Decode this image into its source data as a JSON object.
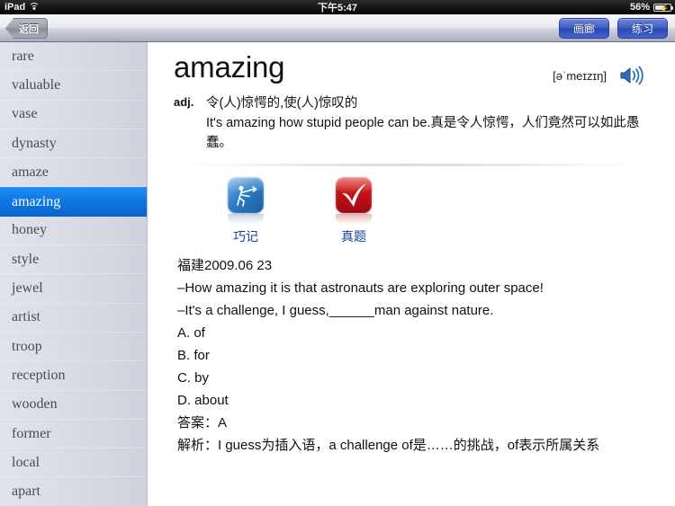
{
  "status_bar": {
    "device": "iPad",
    "wifi_icon": "wifi-icon",
    "time": "下午5:47",
    "battery_percent": "56%",
    "battery_icon": "battery-charging-icon"
  },
  "toolbar": {
    "back_label": "返回",
    "gallery_label": "画廊",
    "practice_label": "练习"
  },
  "sidebar": {
    "items": [
      {
        "label": "rare",
        "selected": false
      },
      {
        "label": "valuable",
        "selected": false
      },
      {
        "label": "vase",
        "selected": false
      },
      {
        "label": "dynasty",
        "selected": false
      },
      {
        "label": "amaze",
        "selected": false
      },
      {
        "label": "amazing",
        "selected": true
      },
      {
        "label": "honey",
        "selected": false
      },
      {
        "label": "style",
        "selected": false
      },
      {
        "label": "jewel",
        "selected": false
      },
      {
        "label": "artist",
        "selected": false
      },
      {
        "label": "troop",
        "selected": false
      },
      {
        "label": "reception",
        "selected": false
      },
      {
        "label": "wooden",
        "selected": false
      },
      {
        "label": "former",
        "selected": false
      },
      {
        "label": "local",
        "selected": false
      },
      {
        "label": "apart",
        "selected": false
      }
    ],
    "selected_color": "#0d74e0",
    "background_color": "#d6dae3"
  },
  "entry": {
    "word": "amazing",
    "phonetic": "[əˈmeɪzɪŋ]",
    "speaker_icon": "speaker-icon",
    "part_of_speech": "adj.",
    "definition_cn": "令(人)惊愕的,使(人)惊叹的",
    "example": "It's amazing how stupid people can be.真是令人惊愕，人们竟然可以如此愚蠢。"
  },
  "icon_buttons": [
    {
      "label": "巧记",
      "icon": "mnemonic-icon",
      "color": "#2f7fc9"
    },
    {
      "label": "真题",
      "icon": "checkmark-icon",
      "color": "#c41018"
    }
  ],
  "exam": {
    "source": "福建2009.06 23",
    "dialogue": [
      "–How amazing it is that astronauts are exploring outer space!",
      "–It's a challenge, I guess,______man against nature."
    ],
    "options": [
      "A. of",
      "B. for",
      "C. by",
      "D. about"
    ],
    "answer": "答案：A",
    "explanation": "解析：I guess为插入语，a challenge of是……的挑战，of表示所属关系"
  }
}
